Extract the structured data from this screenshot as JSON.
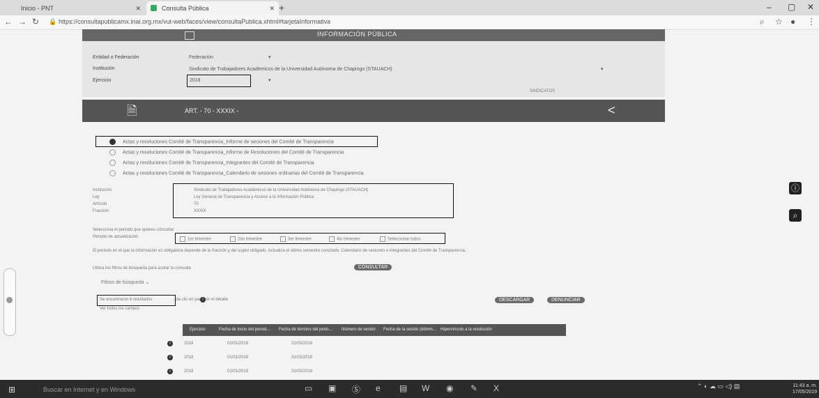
{
  "browser": {
    "tab1": "Inicio - PNT",
    "tab2": "Consulta Pública",
    "url": "https://consultapublicamx.inai.org.mx/vut-web/faces/view/consultaPublica.xhtml#tarjetaInformativa"
  },
  "header": {
    "title": "INFORMACIÓN PÚBLICA",
    "entidad_label": "Entidad o Federación",
    "entidad_value": "Federación",
    "institucion_label": "Institución",
    "institucion_value": "Sindicato de Trabajadores Académicos de la Universidad Autónoma de Chapingo (STAUACH)",
    "ejercicio_label": "Ejercicio",
    "ejercicio_value": "2018",
    "category": "SINDICATOS",
    "article": "ART. - 70 - XXXIX -"
  },
  "options": [
    "Actas y resoluciones Comité de Transparencia_Informe de sesiones del Comité de Transparencia",
    "Actas y resoluciones Comité de Transparencia_Informe de Resoluciones del Comité de Transparencia",
    "Actas y resoluciones Comité de Transparencia_Integrantes del Comité de Transparencia",
    "Actas y resoluciones Comité de Transparencia_Calendario de sesiones ordinarias del Comité de Transparencia"
  ],
  "details": {
    "labels": [
      "Institución",
      "Ley",
      "Artículo",
      "Fracción"
    ],
    "values": [
      "Sindicato de Trabajadores Académicos de la Universidad Autónoma de Chapingo (STAUACH)",
      "Ley General de Transparencia y Acceso a la Información Pública",
      "70",
      "XXXIX"
    ]
  },
  "period": {
    "prompt": "Selecciona el periodo que quieres consultar",
    "label": "Periodo de actualización",
    "options": [
      "1er trimestre",
      "2do trimestre",
      "3er trimestre",
      "4to trimestre",
      "Seleccionar todos"
    ],
    "note": "El periodo en el que la información es obligatoria depende de la fracción y del sujeto obligado. Actualiza el último semestre concluido. Calendario de sesiones e integrantes del Comité de Transparencia.",
    "filter_hint": "Utiliza los filtros de búsqueda para acotar tu consulta",
    "consult_button": "CONSULTAR",
    "filters_toggle": "Filtros de búsqueda"
  },
  "results": {
    "count_text": "Se encontraron 6 resultados",
    "hint_text": ", da clic en  para ver el detalle",
    "all_fields": "Ver todos los campos",
    "download_button": "DESCARGAR",
    "report_button": "DENUNCIAR"
  },
  "table": {
    "columns": [
      "Ejercicio",
      "Fecha de inicio del period...",
      "Fecha de término del perio...",
      "Número de sesión",
      "Fecha de la sesión (ddmm...",
      "Hipervínculo a la resolución"
    ],
    "rows": [
      [
        "2018",
        "01/01/2018",
        "31/03/2018"
      ],
      [
        "2018",
        "01/01/2018",
        "31/03/2018"
      ],
      [
        "2018",
        "01/01/2018",
        "31/03/2018"
      ]
    ]
  },
  "taskbar": {
    "search_placeholder": "Buscar en Internet y en Windows",
    "time": "11:43 a. m.",
    "date": "17/05/2019"
  }
}
